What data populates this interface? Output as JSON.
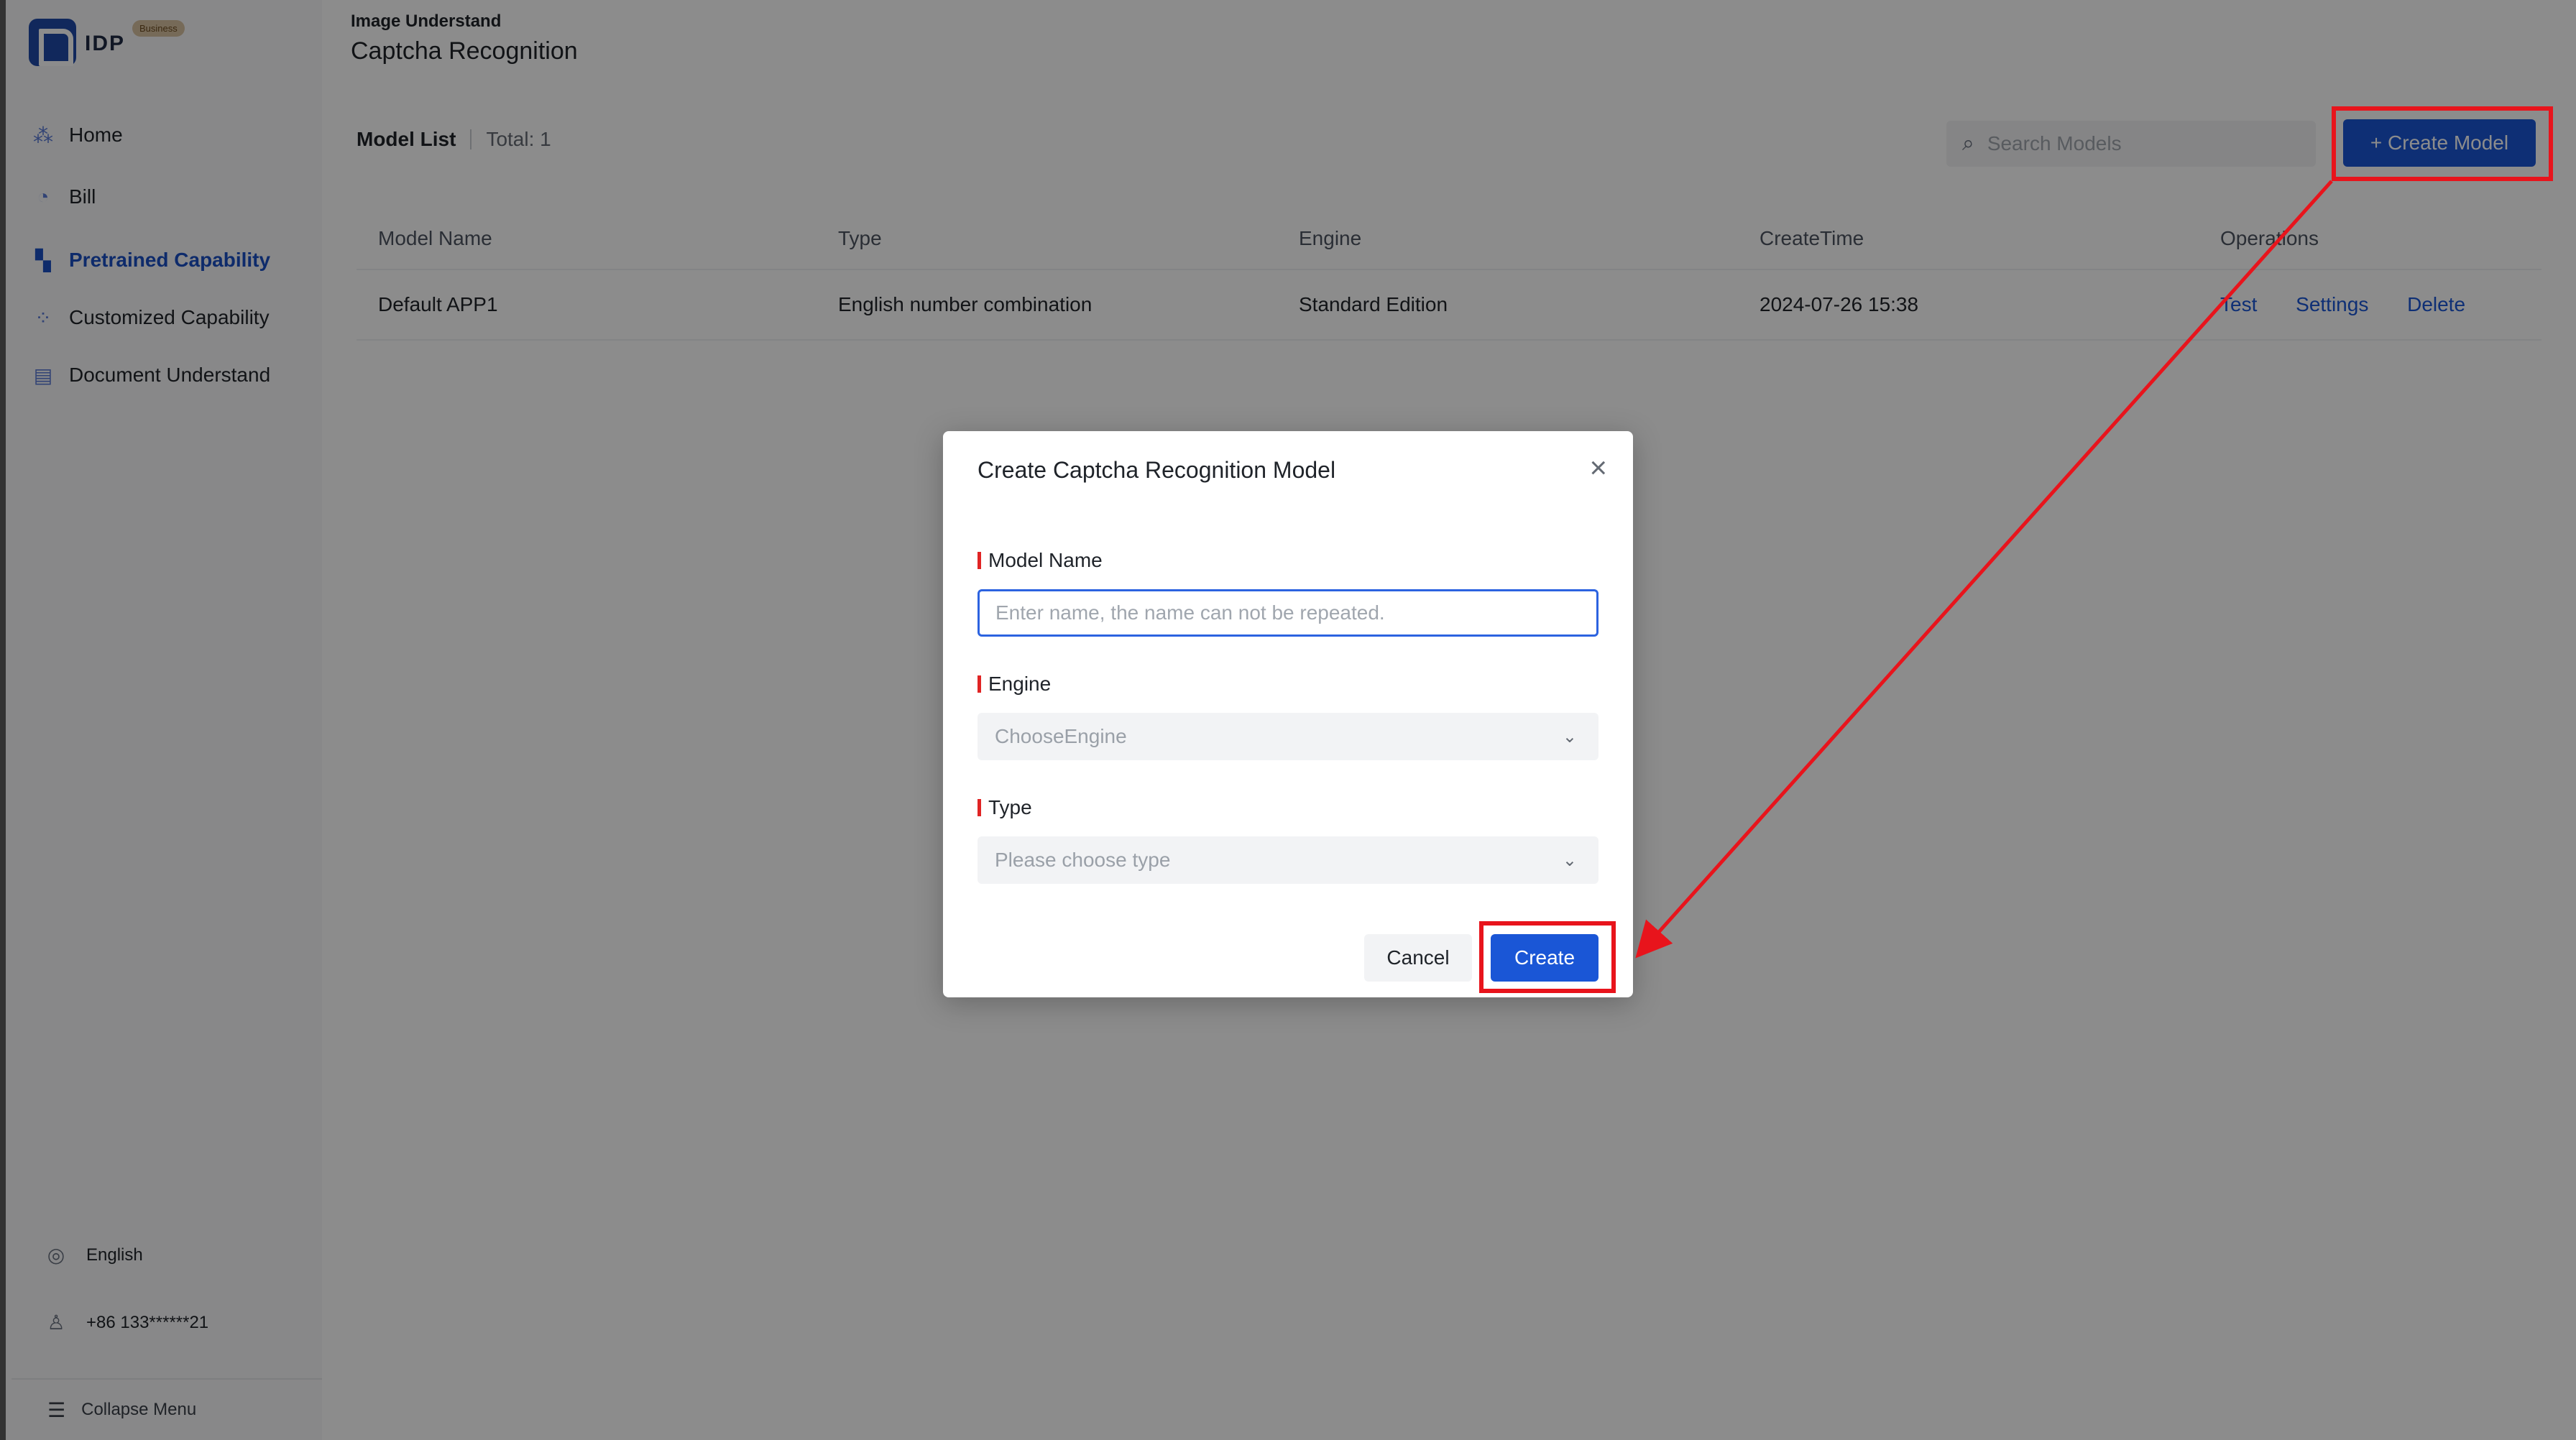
{
  "logo": {
    "text": "IDP",
    "badge": "Business"
  },
  "sidebar": {
    "items": [
      {
        "label": "Home",
        "icon": "home-icon"
      },
      {
        "label": "Bill",
        "icon": "bill-icon"
      },
      {
        "label": "Pretrained Capability",
        "icon": "pretrained-icon",
        "active": true
      },
      {
        "label": "Customized Capability",
        "icon": "customized-icon"
      },
      {
        "label": "Document Understand",
        "icon": "document-icon"
      }
    ],
    "language": "English",
    "account": "+86 133******21",
    "collapse_label": "Collapse Menu"
  },
  "header": {
    "breadcrumb": "Image Understand",
    "title": "Captcha Recognition"
  },
  "list": {
    "title": "Model List",
    "total": "Total: 1",
    "search_placeholder": "Search Models",
    "create_label": "+ Create Model"
  },
  "table": {
    "columns": [
      "Model Name",
      "Type",
      "Engine",
      "CreateTime",
      "Operations"
    ],
    "rows": [
      {
        "name": "Default APP1",
        "type": "English number combination",
        "engine": "Standard Edition",
        "create_time": "2024-07-26 15:38",
        "ops": [
          "Test",
          "Settings",
          "Delete"
        ]
      }
    ]
  },
  "modal": {
    "title": "Create Captcha Recognition Model",
    "model_name_label": "Model Name",
    "model_name_placeholder": "Enter name, the name can not be repeated.",
    "engine_label": "Engine",
    "engine_placeholder": "ChooseEngine",
    "type_label": "Type",
    "type_placeholder": "Please choose type",
    "cancel_label": "Cancel",
    "create_label": "Create"
  },
  "annotation_color": "#e8141c"
}
